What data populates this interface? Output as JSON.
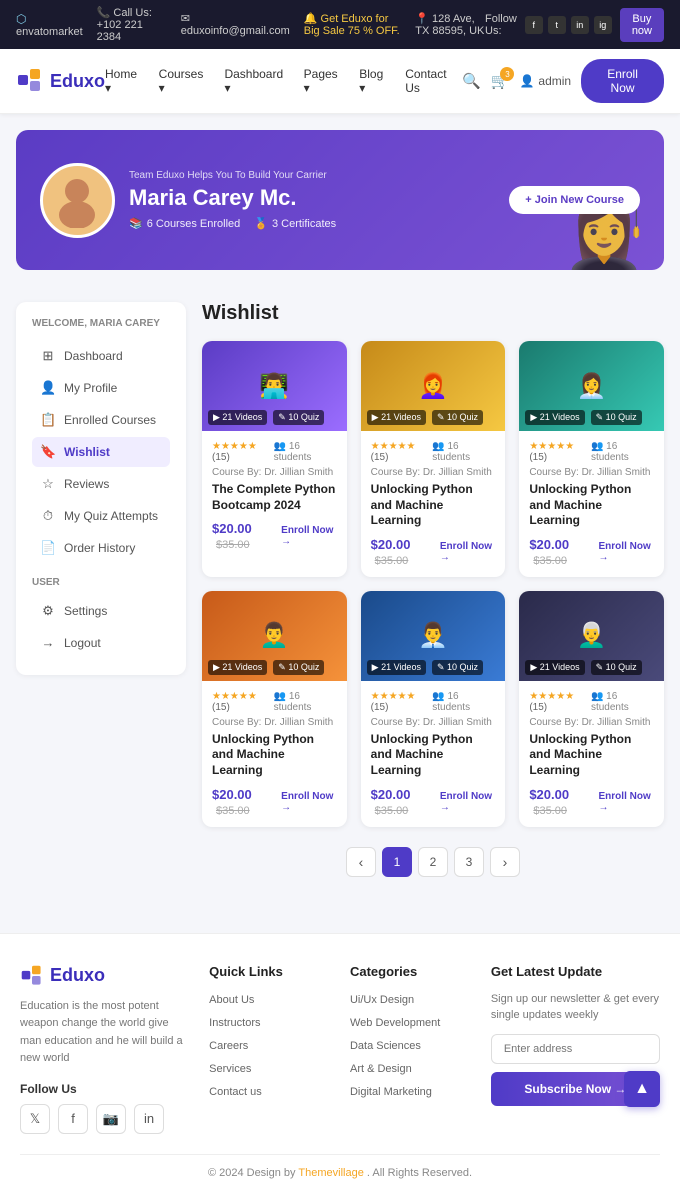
{
  "topbar": {
    "phone": "Call Us: +102 221 2384",
    "email": "eduxoinfo@gmail.com",
    "sale": "Get Eduxo for Big Sale 75 % OFF.",
    "address": "128 Ave, TX 88595, UK",
    "follow": "Follow Us:",
    "buy_now": "Buy now",
    "socials": [
      "f",
      "t",
      "in",
      "ig"
    ]
  },
  "navbar": {
    "logo": "Eduxo",
    "links": [
      "Home",
      "Courses",
      "Dashboard",
      "Pages",
      "Blog",
      "Contact Us"
    ],
    "enroll_now": "Enroll Now",
    "user": "admin",
    "cart_count": "3"
  },
  "hero": {
    "subtitle": "Team Eduxo Helps You To Build Your Carrier",
    "name": "Maria Carey Mc.",
    "courses_enrolled": "6 Courses Enrolled",
    "certificates": "3 Certificates",
    "join_btn": "+ Join New Course"
  },
  "sidebar": {
    "welcome": "WELCOME, MARIA CAREY",
    "menu": [
      {
        "label": "Dashboard",
        "icon": "⊞",
        "active": false
      },
      {
        "label": "My Profile",
        "icon": "👤",
        "active": false
      },
      {
        "label": "Enrolled Courses",
        "icon": "📋",
        "active": false
      },
      {
        "label": "Wishlist",
        "icon": "🔖",
        "active": true
      },
      {
        "label": "Reviews",
        "icon": "☆",
        "active": false
      },
      {
        "label": "My Quiz Attempts",
        "icon": "⏱",
        "active": false
      },
      {
        "label": "Order History",
        "icon": "📄",
        "active": false
      }
    ],
    "user_section": "USER",
    "user_menu": [
      {
        "label": "Settings",
        "icon": "⚙"
      },
      {
        "label": "Logout",
        "icon": "→"
      }
    ]
  },
  "wishlist": {
    "title": "Wishlist",
    "courses": [
      {
        "title": "The Complete Python Bootcamp 2024",
        "instructor": "Course By: Dr. Jillian Smith",
        "price_new": "$20.00",
        "price_old": "$35.00",
        "rating": "★★★★★",
        "rating_count": "(15)",
        "students": "16 students",
        "videos": "21 Videos",
        "quiz": "10 Quiz",
        "enroll": "Enroll Now →",
        "thumb_class": "thumb-purple",
        "emoji": "👨‍💻"
      },
      {
        "title": "Unlocking Python and Machine Learning",
        "instructor": "Course By: Dr. Jillian Smith",
        "price_new": "$20.00",
        "price_old": "$35.00",
        "rating": "★★★★★",
        "rating_count": "(15)",
        "students": "16 students",
        "videos": "21 Videos",
        "quiz": "10 Quiz",
        "enroll": "Enroll Now →",
        "thumb_class": "thumb-gold",
        "emoji": "👩‍🦰"
      },
      {
        "title": "Unlocking Python and Machine Learning",
        "instructor": "Course By: Dr. Jillian Smith",
        "price_new": "$20.00",
        "price_old": "$35.00",
        "rating": "★★★★★",
        "rating_count": "(15)",
        "students": "16 students",
        "videos": "21 Videos",
        "quiz": "10 Quiz",
        "enroll": "Enroll Now →",
        "thumb_class": "thumb-teal",
        "emoji": "👩‍💼"
      },
      {
        "title": "Unlocking Python and Machine Learning",
        "instructor": "Course By: Dr. Jillian Smith",
        "price_new": "$20.00",
        "price_old": "$35.00",
        "rating": "★★★★★",
        "rating_count": "(15)",
        "students": "16 students",
        "videos": "21 Videos",
        "quiz": "10 Quiz",
        "enroll": "Enroll Now →",
        "thumb_class": "thumb-orange",
        "emoji": "👨‍🦱"
      },
      {
        "title": "Unlocking Python and Machine Learning",
        "instructor": "Course By: Dr. Jillian Smith",
        "price_new": "$20.00",
        "price_old": "$35.00",
        "rating": "★★★★★",
        "rating_count": "(15)",
        "students": "16 students",
        "videos": "21 Videos",
        "quiz": "10 Quiz",
        "enroll": "Enroll Now →",
        "thumb_class": "thumb-blue",
        "emoji": "👨‍💼"
      },
      {
        "title": "Unlocking Python and Machine Learning",
        "instructor": "Course By: Dr. Jillian Smith",
        "price_new": "$20.00",
        "price_old": "$35.00",
        "rating": "★★★★★",
        "rating_count": "(15)",
        "students": "16 students",
        "videos": "21 Videos",
        "quiz": "10 Quiz",
        "enroll": "Enroll Now →",
        "thumb_class": "thumb-dark",
        "emoji": "👨‍🦳"
      }
    ]
  },
  "pagination": {
    "prev": "‹",
    "pages": [
      "1",
      "2",
      "3"
    ],
    "next": "›"
  },
  "footer": {
    "logo": "Eduxo",
    "description": "Education is the most potent weapon change the world give man education and he will build a new world",
    "follow_us": "Follow Us",
    "quick_links": {
      "title": "Quick Links",
      "items": [
        "About Us",
        "Instructors",
        "Careers",
        "Services",
        "Contact us"
      ]
    },
    "categories": {
      "title": "Categories",
      "items": [
        "Ui/Ux Design",
        "Web Development",
        "Data Sciences",
        "Art & Design",
        "Digital Marketing"
      ]
    },
    "newsletter": {
      "title": "Get Latest Update",
      "desc": "Sign up our newsletter & get every single updates weekly",
      "placeholder": "Enter address",
      "btn": "Subscribe Now →"
    },
    "copyright": "© 2024 Design by",
    "brand": "Themevillage",
    "rights": ". All Rights Reserved."
  }
}
